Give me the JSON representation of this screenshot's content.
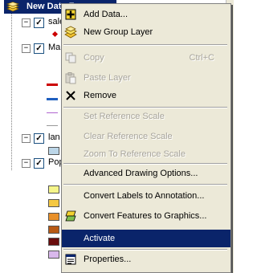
{
  "toc": {
    "data_frame_label": "New Data Frame",
    "layers": [
      {
        "name": "sale",
        "checked": true
      },
      {
        "name": "Ma",
        "checked": true
      },
      {
        "name": "lan",
        "checked": true
      },
      {
        "name": "Pop",
        "checked": true
      }
    ],
    "map_line_colors": [
      "#cc0000",
      "#1f5fbf",
      "#b066d0",
      "#999999"
    ],
    "pop_swatch_colors": [
      "#f5f58a",
      "#f5c842",
      "#e8902a",
      "#b85a14",
      "#6a0d0d",
      "#d9b8ec"
    ],
    "lan_swatch_color": "#bcd6e8"
  },
  "menu": {
    "items": [
      {
        "label": "Add Data...",
        "icon": "add-data-icon",
        "enabled": true
      },
      {
        "label": "New Group Layer",
        "icon": "group-layer-icon",
        "enabled": true
      },
      {
        "label": "Copy",
        "shortcut": "Ctrl+C",
        "icon": "copy-icon",
        "enabled": false
      },
      {
        "label": "Paste Layer",
        "icon": "paste-icon",
        "enabled": false
      },
      {
        "label": "Remove",
        "icon": "remove-icon",
        "enabled": true
      },
      {
        "label": "Set Reference Scale",
        "enabled": false
      },
      {
        "label": "Clear Reference Scale",
        "enabled": false
      },
      {
        "label": "Zoom To Reference Scale",
        "enabled": false
      },
      {
        "label": "Advanced Drawing Options...",
        "enabled": true
      },
      {
        "label": "Convert Labels to Annotation...",
        "enabled": true
      },
      {
        "label": "Convert Features to Graphics...",
        "icon": "convert-graphics-icon",
        "enabled": true
      },
      {
        "label": "Activate",
        "enabled": true,
        "selected": true
      },
      {
        "label": "Properties...",
        "icon": "properties-icon",
        "enabled": true
      }
    ]
  },
  "colors": {
    "selection": "#0a246a",
    "menu_bg": "#ece9d8",
    "disabled_text": "#a8a59c"
  }
}
